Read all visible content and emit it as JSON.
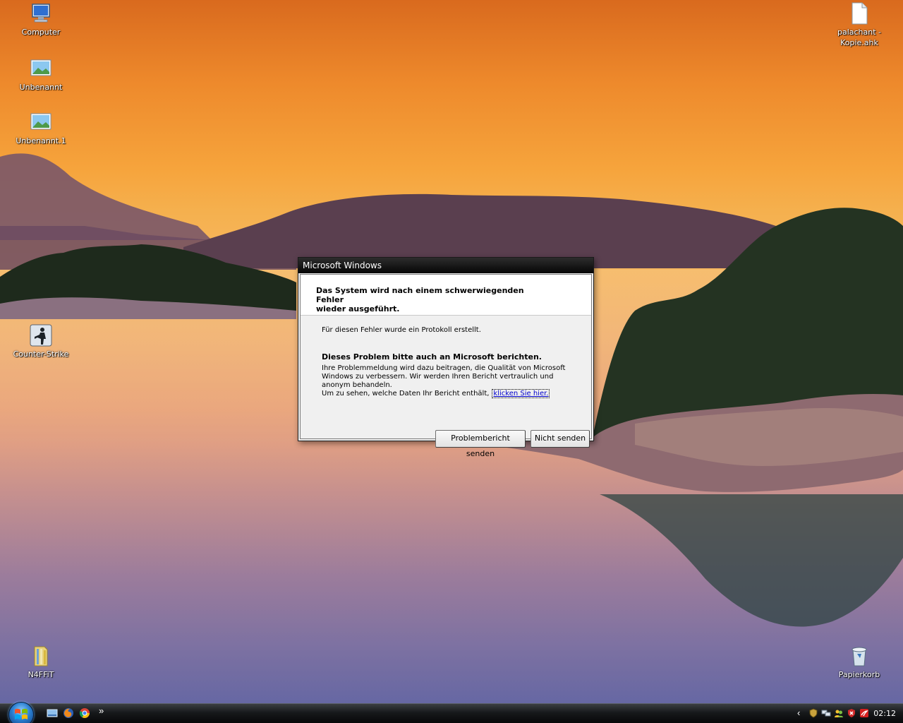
{
  "desktop": {
    "icons": [
      {
        "label": "Computer",
        "icon": "computer-icon"
      },
      {
        "label": "Unbenannt",
        "icon": "image-file-icon"
      },
      {
        "label": "Unbenannt.1",
        "icon": "image-file-icon"
      },
      {
        "label": "Counter-Strike",
        "icon": "counter-strike-icon"
      },
      {
        "label": "N4FFiT",
        "icon": "folder-icon"
      },
      {
        "label": "palachant -\nKopie.ahk",
        "label_line1": "palachant -",
        "label_line2": "Kopie.ahk",
        "icon": "document-icon"
      },
      {
        "label": "Papierkorb",
        "icon": "recycle-bin-icon"
      }
    ]
  },
  "dialog": {
    "title": "Microsoft Windows",
    "heading_line1": "Das System wird nach einem schwerwiegenden Fehler",
    "heading_line2": "wieder ausgeführt.",
    "info": "Für diesen Fehler wurde ein Protokoll erstellt.",
    "subheading": "Dieses Problem bitte auch an Microsoft berichten.",
    "body_line1": "Ihre Problemmeldung wird dazu beitragen, die Qualität von Microsoft",
    "body_line2": "Windows zu verbessern. Wir werden Ihren Bericht vertraulich und",
    "body_line3": "anonym behandeln.",
    "body_line4": "Um zu sehen, welche Daten Ihr Bericht enthält,",
    "link": "klicken Sie hier.",
    "send_button": "Problembericht senden",
    "dont_send_button": "Nicht senden"
  },
  "taskbar": {
    "start": "start-orb-icon",
    "quick_launch": [
      "show-desktop-icon",
      "firefox-icon",
      "chrome-icon"
    ],
    "more": "»",
    "tray_expand": "‹",
    "tray_icons": [
      "shield-icon",
      "network-icon",
      "users-icon",
      "security-alert-icon",
      "antivirus-icon"
    ],
    "clock": "02:12"
  },
  "colors": {
    "sky_top": "#d96a1e",
    "sky_mid": "#f6a43c",
    "water_bottom": "#5e64a0",
    "taskbar": "#16181a",
    "titlebar": "#050505",
    "link": "#0000cc"
  }
}
